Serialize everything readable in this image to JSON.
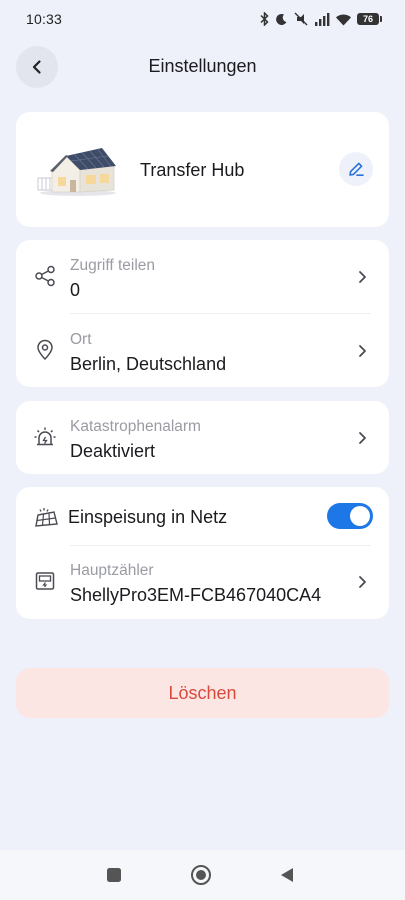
{
  "status_bar": {
    "time": "10:33",
    "battery": "76",
    "icons": [
      "bluetooth-icon",
      "moon-icon",
      "mute-icon",
      "signal-icon",
      "wifi-icon",
      "battery-icon"
    ]
  },
  "header": {
    "title": "Einstellungen",
    "back_icon": "chevron-left-icon"
  },
  "device": {
    "name": "Transfer Hub",
    "image": "house-solar-icon",
    "edit_icon": "pencil-icon"
  },
  "sharing": {
    "label": "Zugriff teilen",
    "value": "0",
    "icon": "share-icon"
  },
  "location": {
    "label": "Ort",
    "value": "Berlin, Deutschland",
    "icon": "location-pin-icon"
  },
  "alarm": {
    "label": "Katastrophenalarm",
    "value": "Deaktiviert",
    "icon": "alarm-light-icon"
  },
  "feed_in": {
    "label": "Einspeisung in Netz",
    "enabled": true,
    "icon": "solar-panel-icon"
  },
  "meter": {
    "label": "Hauptzähler",
    "value": "ShellyPro3EM-FCB467040CA4",
    "icon": "meter-icon"
  },
  "delete": {
    "label": "Löschen"
  },
  "colors": {
    "accent": "#1e77e6",
    "background": "#eef1fa",
    "danger_text": "#d84a3c",
    "danger_bg": "#fbe6e4"
  }
}
